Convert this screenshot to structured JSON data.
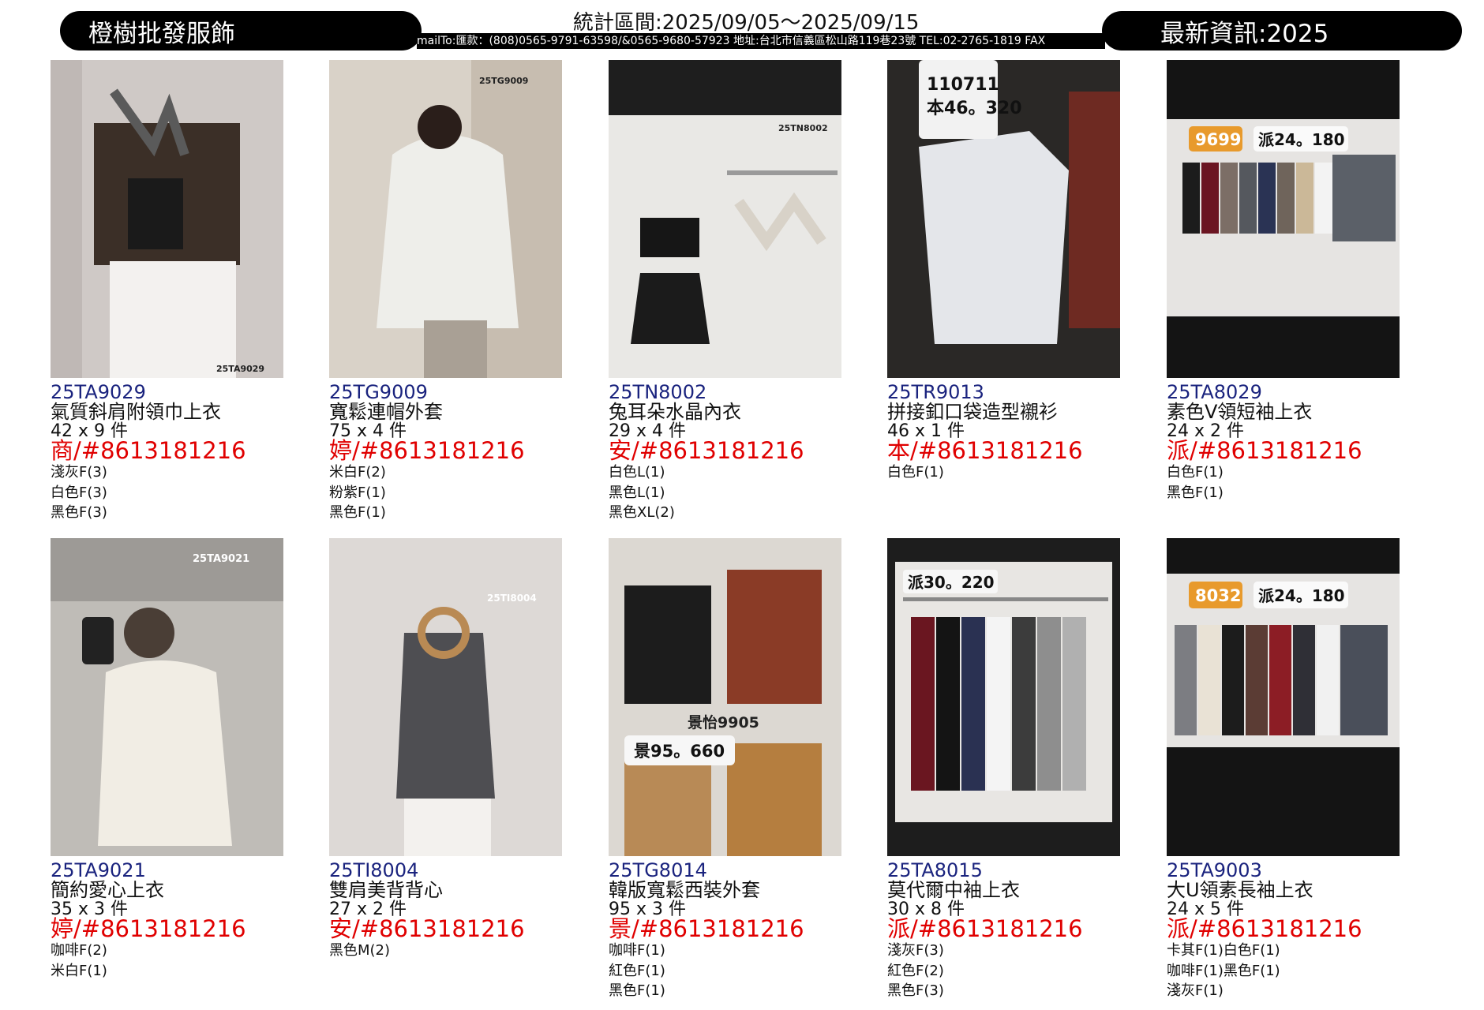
{
  "header": {
    "brand": "橙樹批發服飾",
    "period": "統計區間:2025/09/05～2025/09/15",
    "contact": "mailTo:匯款：(808)0565-9791-63598/&0565-9680-57923 地址:台北市信義區松山路119巷23號 TEL:02-2765-1819 FAX",
    "latest": "最新資訊:2025"
  },
  "products": [
    {
      "code": "25TA9029",
      "name": "氣質斜肩附領巾上衣",
      "qty": "42 x 9 件",
      "phone": "商/#8613181216",
      "variants": [
        "淺灰F(3)",
        "白色F(3)",
        "黑色F(3)"
      ],
      "photo_tag": "25TA9029",
      "photo_badge": ""
    },
    {
      "code": "25TG9009",
      "name": "寬鬆連帽外套",
      "qty": "75 x 4 件",
      "phone": "婷/#8613181216",
      "variants": [
        "米白F(2)",
        "粉紫F(1)",
        "黑色F(1)"
      ],
      "photo_tag": "25TG9009",
      "photo_badge": ""
    },
    {
      "code": "25TN8002",
      "name": "兔耳朵水晶內衣",
      "qty": "29 x 4 件",
      "phone": "安/#8613181216",
      "variants": [
        "白色L(1)",
        "黑色L(1)",
        "黑色XL(2)"
      ],
      "photo_tag": "25TN8002",
      "photo_badge": ""
    },
    {
      "code": "25TR9013",
      "name": "拼接釦口袋造型襯衫",
      "qty": "46 x 1 件",
      "phone": "本/#8613181216",
      "variants": [
        "白色F(1)"
      ],
      "photo_tag": "110711",
      "photo_badge": "本46。320"
    },
    {
      "code": "25TA8029",
      "name": "素色V領短袖上衣",
      "qty": "24 x 2 件",
      "phone": "派/#8613181216",
      "variants": [
        "白色F(1)",
        "黑色F(1)"
      ],
      "photo_tag": "9699",
      "photo_badge": "派24。180"
    },
    {
      "code": "25TA9021",
      "name": "簡約愛心上衣",
      "qty": "35 x 3 件",
      "phone": "婷/#8613181216",
      "variants": [
        "咖啡F(2)",
        "米白F(1)"
      ],
      "photo_tag": "25TA9021",
      "photo_badge": ""
    },
    {
      "code": "25TI8004",
      "name": "雙肩美背背心",
      "qty": "27 x 2 件",
      "phone": "安/#8613181216",
      "variants": [
        "黑色M(2)"
      ],
      "photo_tag": "25TI8004",
      "photo_badge": ""
    },
    {
      "code": "25TG8014",
      "name": "韓版寬鬆西裝外套",
      "qty": "95 x 3 件",
      "phone": "景/#8613181216",
      "variants": [
        "咖啡F(1)",
        "紅色F(1)",
        "黑色F(1)"
      ],
      "photo_tag": "景怡9905",
      "photo_badge": "景95。660"
    },
    {
      "code": "25TA8015",
      "name": "莫代爾中袖上衣",
      "qty": "30 x 8 件",
      "phone": "派/#8613181216",
      "variants": [
        "淺灰F(3)",
        "紅色F(2)",
        "黑色F(3)"
      ],
      "photo_tag": "",
      "photo_badge": "派30。220"
    },
    {
      "code": "25TA9003",
      "name": "大U領素長袖上衣",
      "qty": "24 x 5 件",
      "phone": "派/#8613181216",
      "variants": [
        "卡其F(1)白色F(1)",
        "咖啡F(1)黑色F(1)",
        "淺灰F(1)"
      ],
      "photo_tag": "8032",
      "photo_badge": "派24。180"
    }
  ]
}
